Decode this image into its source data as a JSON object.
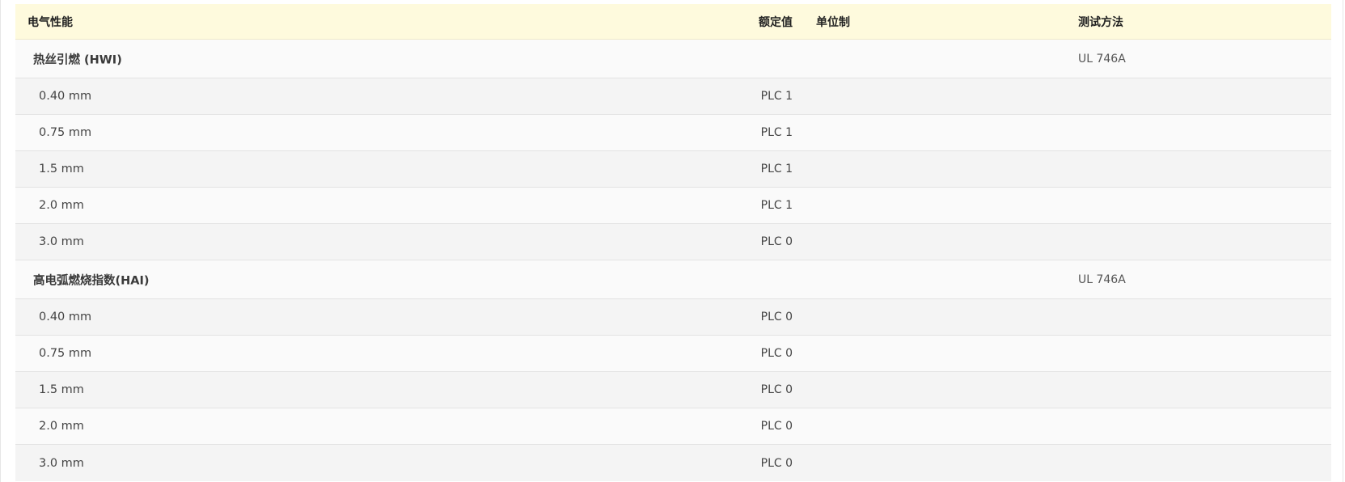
{
  "table": {
    "headers": {
      "property": "电气性能",
      "value": "额定值",
      "unit": "单位制",
      "method": "测试方法"
    },
    "groups": [
      {
        "label": "热丝引燃 (HWI)",
        "method": "UL 746A",
        "rows": [
          {
            "thickness": "0.40 mm",
            "value": "PLC 1"
          },
          {
            "thickness": "0.75 mm",
            "value": "PLC 1"
          },
          {
            "thickness": "1.5 mm",
            "value": "PLC 1"
          },
          {
            "thickness": "2.0 mm",
            "value": "PLC 1"
          },
          {
            "thickness": "3.0 mm",
            "value": "PLC 0"
          }
        ]
      },
      {
        "label": "高电弧燃烧指数(HAI)",
        "method": "UL 746A",
        "rows": [
          {
            "thickness": "0.40 mm",
            "value": "PLC 0"
          },
          {
            "thickness": "0.75 mm",
            "value": "PLC 0"
          },
          {
            "thickness": "1.5 mm",
            "value": "PLC 0"
          },
          {
            "thickness": "2.0 mm",
            "value": "PLC 0"
          },
          {
            "thickness": "3.0 mm",
            "value": "PLC 0"
          }
        ]
      }
    ]
  }
}
